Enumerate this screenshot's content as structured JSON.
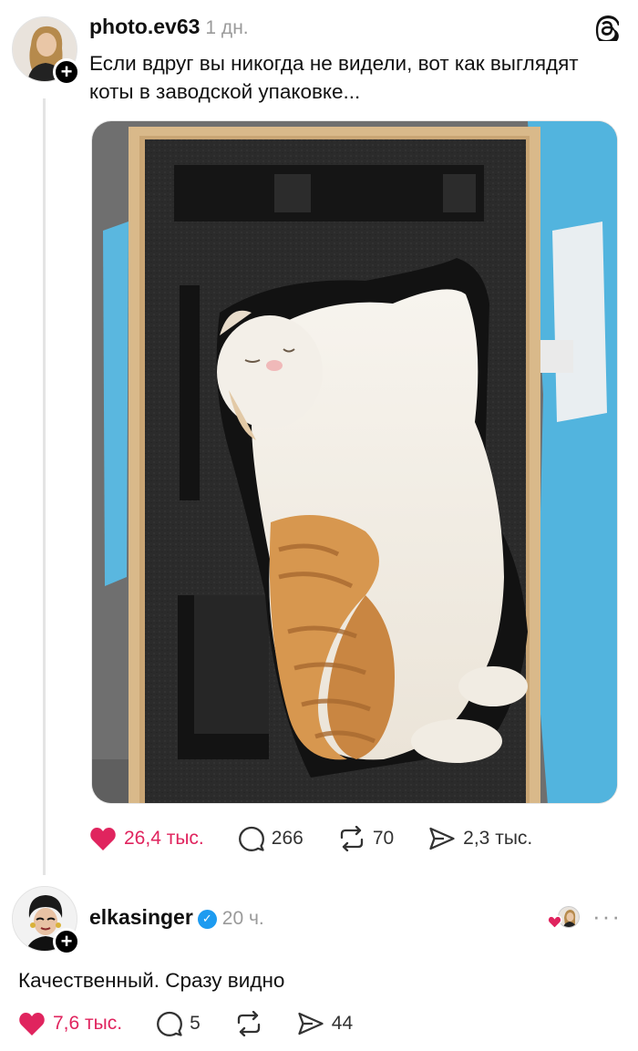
{
  "post": {
    "username": "photo.ev63",
    "time": "1 дн.",
    "text": "Если вдруг вы никогда не видели, вот как выглядят коты в заводской упаковке...",
    "actions": {
      "likes": "26,4 тыс.",
      "comments": "266",
      "reposts": "70",
      "shares": "2,3 тыс."
    }
  },
  "reply": {
    "username": "elkasinger",
    "time": "20 ч.",
    "text": "Качественный. Сразу видно",
    "actions": {
      "likes": "7,6 тыс.",
      "comments": "5",
      "shares": "44"
    }
  },
  "colors": {
    "like_red": "#e0245e",
    "verified_blue": "#1d9bf0",
    "foam": "#2a2a2a",
    "plywood": "#d9b98a",
    "bag_blue": "#4fb6e0"
  },
  "icons": [
    "threads-logo-icon",
    "heart-icon",
    "comment-icon",
    "repost-icon",
    "share-icon",
    "verified-icon",
    "more-icon",
    "plus-icon"
  ]
}
